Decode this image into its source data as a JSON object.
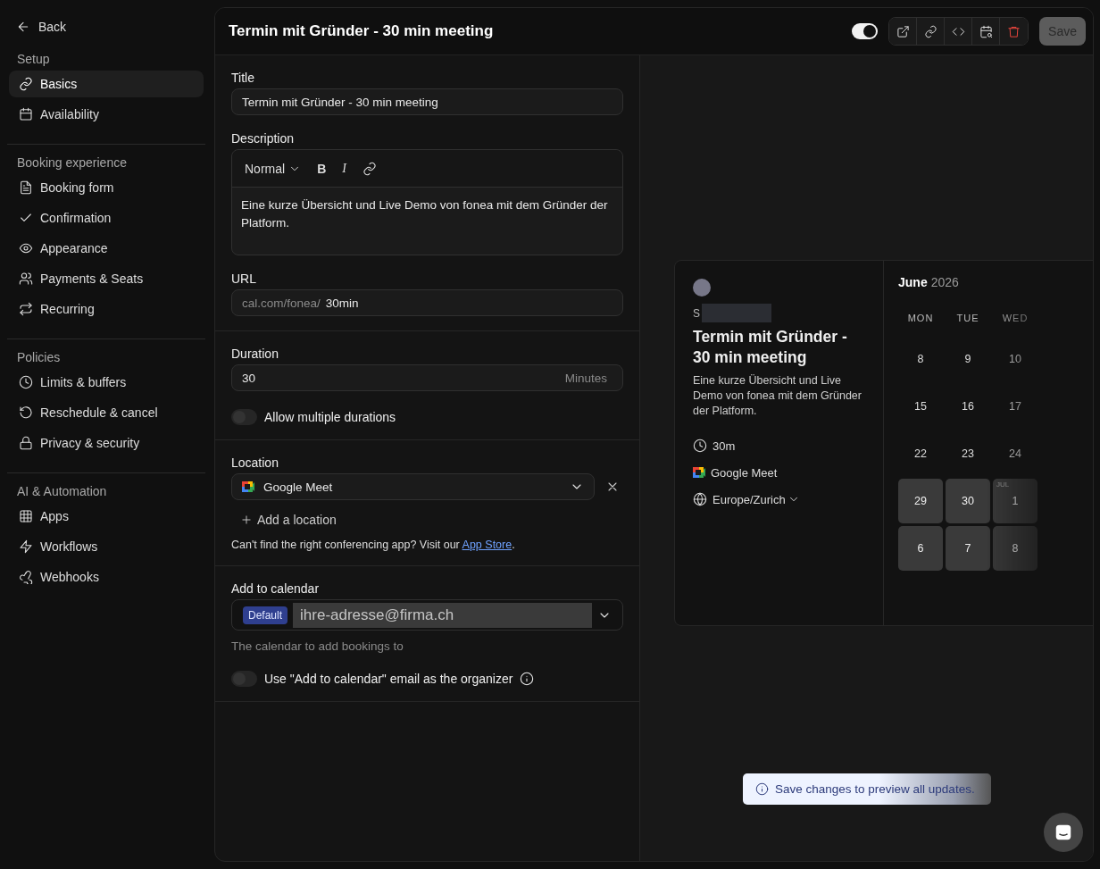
{
  "sidebar": {
    "back": "Back",
    "sections": [
      {
        "heading": "Setup",
        "items": [
          {
            "label": "Basics",
            "selected": true
          },
          {
            "label": "Availability",
            "selected": false
          }
        ]
      },
      {
        "heading": "Booking experience",
        "items": [
          {
            "label": "Booking form",
            "selected": false
          },
          {
            "label": "Confirmation",
            "selected": false
          },
          {
            "label": "Appearance",
            "selected": false
          },
          {
            "label": "Payments & Seats",
            "selected": false
          },
          {
            "label": "Recurring",
            "selected": false
          }
        ]
      },
      {
        "heading": "Policies",
        "items": [
          {
            "label": "Limits & buffers",
            "selected": false
          },
          {
            "label": "Reschedule & cancel",
            "selected": false
          },
          {
            "label": "Privacy & security",
            "selected": false
          }
        ]
      },
      {
        "heading": "AI & Automation",
        "items": [
          {
            "label": "Apps",
            "selected": false
          },
          {
            "label": "Workflows",
            "selected": false
          },
          {
            "label": "Webhooks",
            "selected": false
          }
        ]
      }
    ]
  },
  "header": {
    "title": "Termin mit Gründer - 30 min meeting",
    "toggle": {
      "on": true
    },
    "save": {
      "label": "Save",
      "disabled": true
    }
  },
  "form": {
    "title": {
      "label": "Title",
      "value": "Termin mit Gründer - 30 min meeting"
    },
    "description": {
      "label": "Description",
      "style": "Normal",
      "bold": "B",
      "italic": "I",
      "value": "Eine kurze Übersicht und Live Demo von fonea mit dem Gründer der Platform."
    },
    "url": {
      "label": "URL",
      "prefix": "cal.com/fonea/",
      "value": "30min"
    },
    "duration": {
      "label": "Duration",
      "value": "30",
      "suffix": "Minutes",
      "multiple": {
        "label": "Allow multiple durations",
        "on": false
      }
    },
    "location": {
      "label": "Location",
      "value": "Google Meet",
      "add": "Add a location",
      "help": "Can't find the right conferencing app? Visit our ",
      "help_link": "App Store",
      "help_end": "."
    },
    "calendar": {
      "label": "Add to calendar",
      "badge": "Default",
      "value": "ihre-adresse@firma.ch",
      "hint": "The calendar to add bookings to",
      "organizer": {
        "label": "Use \"Add to calendar\" email as the organizer",
        "on": false
      }
    }
  },
  "preview": {
    "host_initial": "S",
    "title": "Termin mit Gründer - 30 min meeting",
    "description": "Eine kurze Übersicht und Live Demo von fonea mit dem Gründer der Platform.",
    "duration": "30m",
    "location": "Google Meet",
    "timezone": "Europe/Zurich",
    "month": "June",
    "year": "2026",
    "weekdays": [
      "MON",
      "TUE",
      "WED"
    ],
    "weeks": [
      [
        {
          "day": "8",
          "available": false
        },
        {
          "day": "9",
          "available": false
        },
        {
          "day": "10",
          "available": false
        }
      ],
      [
        {
          "day": "15",
          "available": false
        },
        {
          "day": "16",
          "available": false
        },
        {
          "day": "17",
          "available": false
        }
      ],
      [
        {
          "day": "22",
          "available": false
        },
        {
          "day": "23",
          "available": false
        },
        {
          "day": "24",
          "available": false
        }
      ],
      [
        {
          "day": "29",
          "available": true
        },
        {
          "day": "30",
          "available": true
        },
        {
          "day": "1",
          "month": "JUL",
          "available": true
        }
      ],
      [
        {
          "day": "6",
          "available": true
        },
        {
          "day": "7",
          "available": true
        },
        {
          "day": "8",
          "available": true
        }
      ]
    ]
  },
  "toast": "Save changes to preview all updates."
}
